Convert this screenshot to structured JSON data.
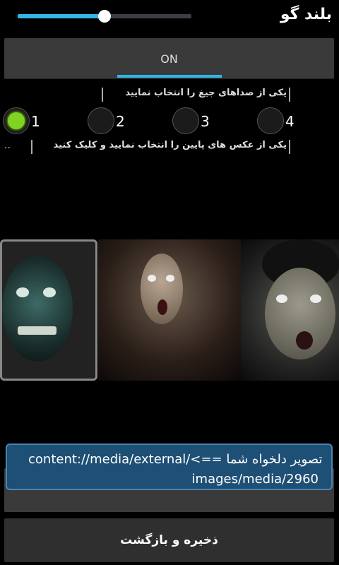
{
  "volume": {
    "label": "بلند گو",
    "level": 0.5
  },
  "toggle": {
    "label": "ON",
    "checked": true
  },
  "sound_hint": "یکی از صداهای جیغ را انتخاب نمایید",
  "radios": [
    {
      "label": "1",
      "selected": true
    },
    {
      "label": "2",
      "selected": false
    },
    {
      "label": "3",
      "selected": false
    },
    {
      "label": "4",
      "selected": false
    }
  ],
  "image_hint": "یکی از عکس های پایین را انتخاب نمایید و کلیک کنید",
  "dots": "..",
  "images": [
    "scary-face-green",
    "scary-girl",
    "zombie-face"
  ],
  "toast": {
    "line1": "content://media/external/<== تصویر دلخواه شما",
    "line2": "images/media/2960"
  },
  "buttons": {
    "save_back": "ذخیره و بازگشت"
  },
  "colors": {
    "accent": "#33b5e5",
    "radio_active": "#7fd321",
    "toast_bg": "#1e4f75"
  }
}
